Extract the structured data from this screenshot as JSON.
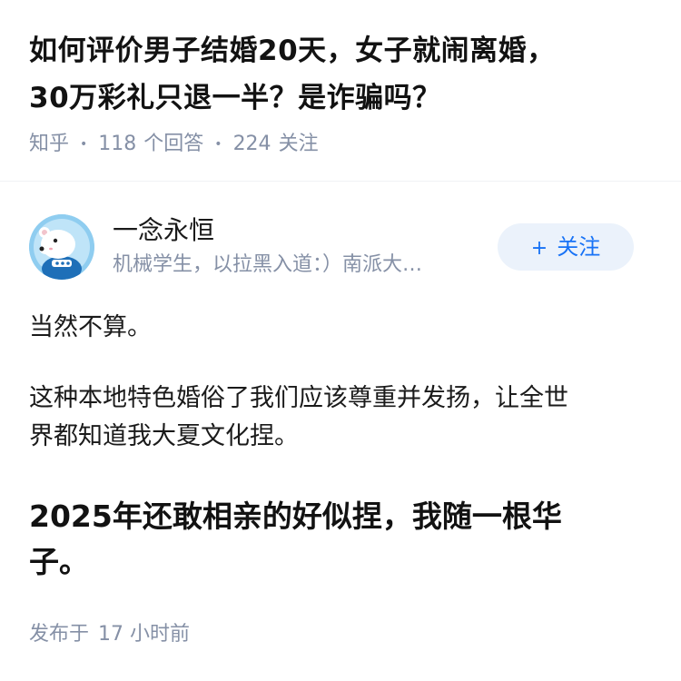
{
  "question": {
    "title_line1": "如何评价男子结婚20天，女子就闹离婚，",
    "title_line2": "30万彩礼只退一半？是诈骗吗？",
    "source": "知乎",
    "answer_count": "118",
    "answer_count_label": "个回答",
    "follower_count": "224",
    "follower_count_label": "关注"
  },
  "author": {
    "name": "一念永恒",
    "bio": "机械学生，以拉黑入道：）南派大…",
    "avatar_icon": "polar-bear-astronaut-avatar",
    "follow_label": "关注",
    "follow_icon": "plus-icon",
    "accent_color": "#1772f6"
  },
  "answer": {
    "paragraph1": "当然不算。",
    "paragraph2_line1": "这种本地特色婚俗了我们应该尊重并发扬，让全世",
    "paragraph2_line2": "界都知道我大夏文化捏。",
    "bold_line1": "2025年还敢相亲的好似捏，我随一根华",
    "bold_line2": "子。",
    "publish_label": "发布于",
    "publish_time": "17 小时前"
  }
}
